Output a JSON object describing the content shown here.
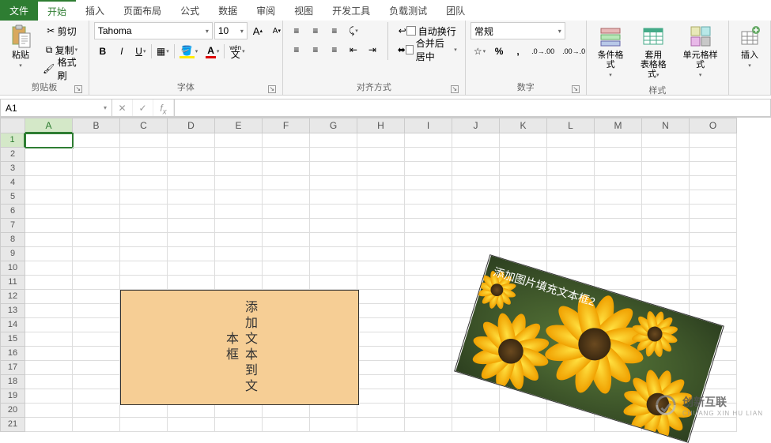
{
  "tabs": {
    "file": "文件",
    "home": "开始",
    "insert": "插入",
    "layout": "页面布局",
    "formula": "公式",
    "data": "数据",
    "review": "审阅",
    "view": "视图",
    "dev": "开发工具",
    "load": "负载测试",
    "team": "团队"
  },
  "clipboard": {
    "paste": "粘贴",
    "cut": "剪切",
    "copy": "复制",
    "format_painter": "格式刷",
    "group": "剪贴板"
  },
  "font": {
    "name": "Tahoma",
    "size": "10",
    "wen_label": "wén",
    "wen_char": "文",
    "group": "字体"
  },
  "align": {
    "wrap": "自动换行",
    "merge": "合并后居中",
    "group": "对齐方式"
  },
  "number": {
    "format": "常规",
    "group": "数字"
  },
  "styles": {
    "cond": "条件格式",
    "table_l1": "套用",
    "table_l2": "表格格式",
    "cell": "单元格样式",
    "group": "样式"
  },
  "insert_group": {
    "label": "插入"
  },
  "cellref": {
    "name": "A1"
  },
  "columns": [
    "A",
    "B",
    "C",
    "D",
    "E",
    "F",
    "G",
    "H",
    "I",
    "J",
    "K",
    "L",
    "M",
    "N",
    "O"
  ],
  "shape1_text": "添加文本到文本框",
  "shape2_text": "添加图片填充文本框2",
  "watermark": {
    "brand": "创新互联",
    "sub": "CHUANG XIN HU LIAN"
  }
}
